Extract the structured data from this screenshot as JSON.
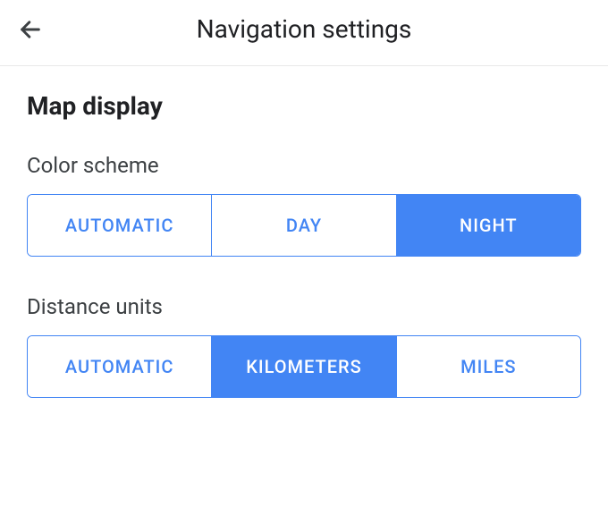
{
  "header": {
    "title": "Navigation settings"
  },
  "section": {
    "heading": "Map display"
  },
  "color_scheme": {
    "label": "Color scheme",
    "options": [
      {
        "label": "AUTOMATIC",
        "selected": false
      },
      {
        "label": "DAY",
        "selected": false
      },
      {
        "label": "NIGHT",
        "selected": true
      }
    ]
  },
  "distance_units": {
    "label": "Distance units",
    "options": [
      {
        "label": "AUTOMATIC",
        "selected": false
      },
      {
        "label": "KILOMETERS",
        "selected": true
      },
      {
        "label": "MILES",
        "selected": false
      }
    ]
  }
}
